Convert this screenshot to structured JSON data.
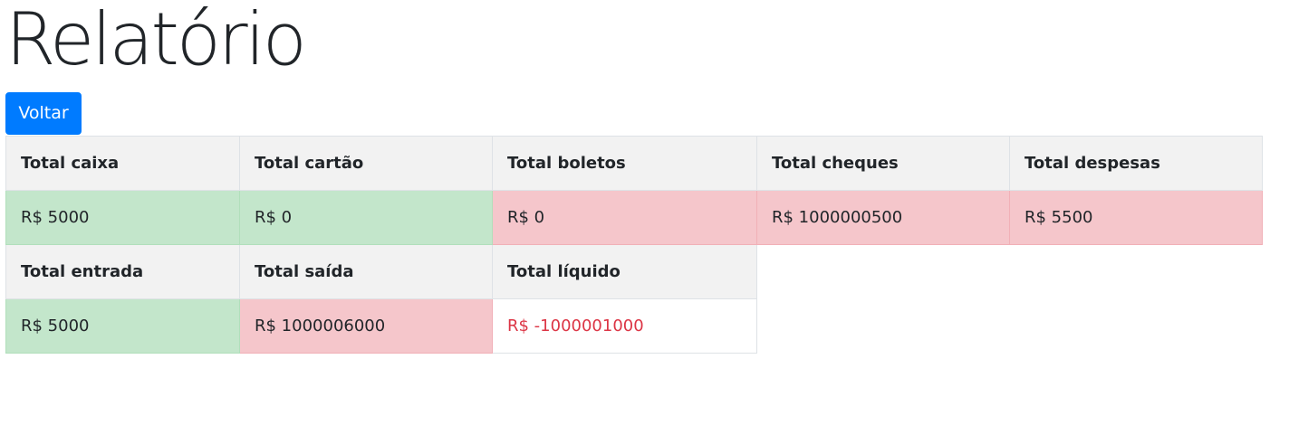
{
  "page": {
    "title": "Relatório",
    "back_label": "Voltar"
  },
  "colors": {
    "primary": "#007bff",
    "success_bg": "#c3e6cb",
    "danger_bg": "#f5c6cb",
    "header_bg": "#f2f2f2",
    "negative_text": "#dc3545"
  },
  "report": {
    "row1": {
      "headers": [
        "Total caixa",
        "Total cartão",
        "Total boletos",
        "Total cheques",
        "Total despesas"
      ],
      "values": [
        "R$ 5000",
        "R$ 0",
        "R$ 0",
        "R$ 1000000500",
        "R$ 5500"
      ]
    },
    "row2": {
      "headers": [
        "Total entrada",
        "Total saída",
        "Total líquido"
      ],
      "values": [
        "R$ 5000",
        "R$ 1000006000",
        "R$ -1000001000"
      ]
    }
  }
}
